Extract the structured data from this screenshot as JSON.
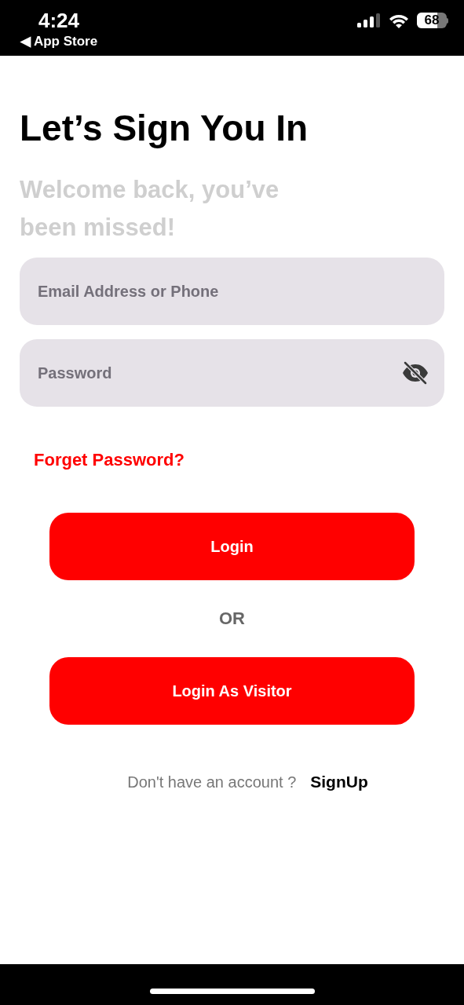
{
  "status_bar": {
    "time": "4:24",
    "back_label": "◀ App Store",
    "battery": "68"
  },
  "title": "Let’s Sign You In",
  "subtitle": "Welcome back, you’ve been missed!",
  "fields": [
    {
      "kind": "text",
      "placeholder": "Email Address or Phone"
    },
    {
      "kind": "password",
      "placeholder": "Password"
    }
  ],
  "forgot_link": "Forget Password?",
  "login_button": "Login",
  "divider_text": "OR",
  "visitor_button": "Login As Visitor",
  "signup_prompt": "Don't have an account ?",
  "signup_link": "SignUp"
}
